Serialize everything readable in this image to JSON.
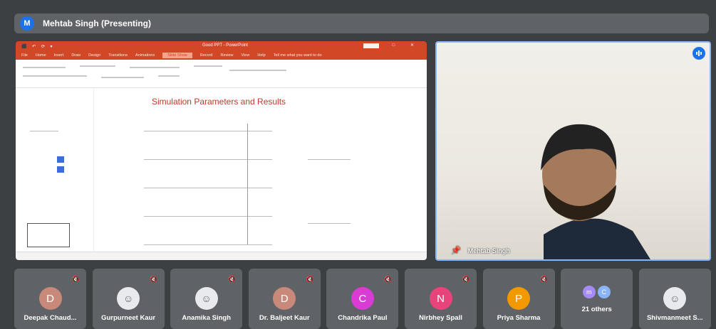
{
  "presenter_bar": {
    "badge": "M",
    "label": "Mehtab Singh (Presenting)"
  },
  "shared_screen": {
    "titlebar": {
      "doc_title": "Good PPT - PowerPoint",
      "quick_access": "⬛ ↶ ⟳ ▾",
      "window_controls": "— □ ✕"
    },
    "menu_tabs": [
      "File",
      "Home",
      "Insert",
      "Draw",
      "Design",
      "Transitions",
      "Animations",
      "Slide Show",
      "Record",
      "Review",
      "View",
      "Help",
      "Tell me what you want to do"
    ],
    "active_tab_index": 7,
    "slide_title": "Simulation Parameters and Results"
  },
  "camera": {
    "name": "Mehtab Singh",
    "speaking_icon": "audio-level-icon",
    "pin_icon": "pin-icon"
  },
  "participants": [
    {
      "name": "Deepak Chaud...",
      "initial": "D",
      "color": "#c9897a",
      "photo": false
    },
    {
      "name": "Gurpurneet Kaur",
      "initial": "",
      "color": "#e8eaed",
      "photo": true
    },
    {
      "name": "Anamika Singh",
      "initial": "",
      "color": "#e8eaed",
      "photo": true
    },
    {
      "name": "Dr. Baljeet Kaur",
      "initial": "D",
      "color": "#c9897a",
      "photo": false
    },
    {
      "name": "Chandrika Paul",
      "initial": "C",
      "color": "#d93bd4",
      "photo": false
    },
    {
      "name": "Nirbhey Spall",
      "initial": "N",
      "color": "#e8447b",
      "photo": false
    },
    {
      "name": "Priya Sharma",
      "initial": "P",
      "color": "#f29900",
      "photo": false
    }
  ],
  "others_tile": {
    "label": "21 others",
    "avatars": [
      {
        "initial": "m",
        "color": "#a78bf5"
      },
      {
        "initial": "C",
        "color": "#8ab4f8"
      }
    ]
  },
  "last_participant": {
    "name": "Shivmanmeet S...",
    "photo": true
  }
}
